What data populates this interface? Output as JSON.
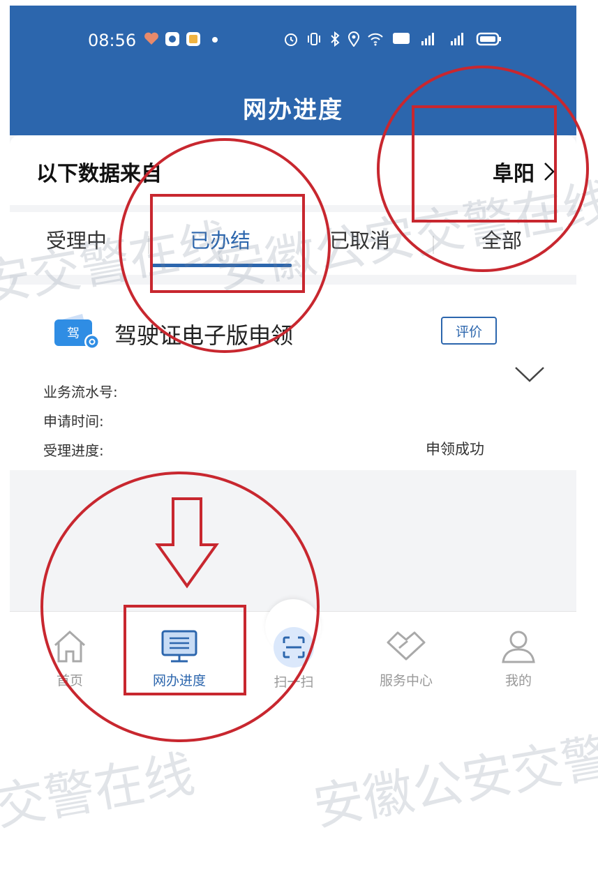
{
  "status_bar": {
    "time": "08:56"
  },
  "header": {
    "title": "网办进度"
  },
  "source": {
    "label": "以下数据来自",
    "city": "阜阳"
  },
  "tabs": [
    {
      "label": "受理中",
      "active": false
    },
    {
      "label": "已办结",
      "active": true
    },
    {
      "label": "已取消",
      "active": false
    },
    {
      "label": "全部",
      "active": false
    }
  ],
  "card": {
    "icon_text": "驾",
    "title": "驾驶证电子版申领",
    "rate_button": "评价",
    "fields": {
      "serial_label": "业务流水号:",
      "time_label": "申请时间:",
      "progress_label": "受理进度:",
      "progress_value": "申领成功"
    }
  },
  "nav": [
    {
      "label": "首页",
      "icon": "home-icon",
      "active": false
    },
    {
      "label": "网办进度",
      "icon": "monitor-icon",
      "active": true
    },
    {
      "label": "扫一扫",
      "icon": "scan-icon",
      "active": false
    },
    {
      "label": "服务中心",
      "icon": "handshake-icon",
      "active": false
    },
    {
      "label": "我的",
      "icon": "user-icon",
      "active": false
    }
  ],
  "watermark": {
    "text": "安徽公安交警在线"
  },
  "colors": {
    "primary": "#2c66ad",
    "annotation": "#c8272f"
  }
}
